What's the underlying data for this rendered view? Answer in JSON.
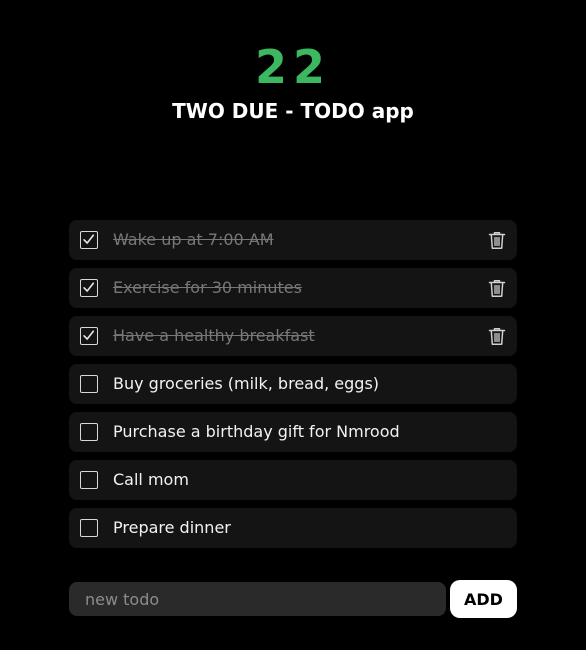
{
  "header": {
    "logo": "22",
    "title": "TWO DUE - TODO app",
    "logo_color": "#3cb960"
  },
  "todos": [
    {
      "text": "Wake up at 7:00 AM",
      "done": true
    },
    {
      "text": "Exercise for 30 minutes",
      "done": true
    },
    {
      "text": "Have a healthy breakfast",
      "done": true
    },
    {
      "text": "Buy groceries (milk, bread, eggs)",
      "done": false
    },
    {
      "text": "Purchase a birthday gift for Nmrood",
      "done": false
    },
    {
      "text": "Call mom",
      "done": false
    },
    {
      "text": "Prepare dinner",
      "done": false
    }
  ],
  "form": {
    "placeholder": "new todo",
    "value": "",
    "add_label": "ADD"
  },
  "icons": {
    "checkbox_checked": "check-icon",
    "delete": "trash-icon"
  }
}
